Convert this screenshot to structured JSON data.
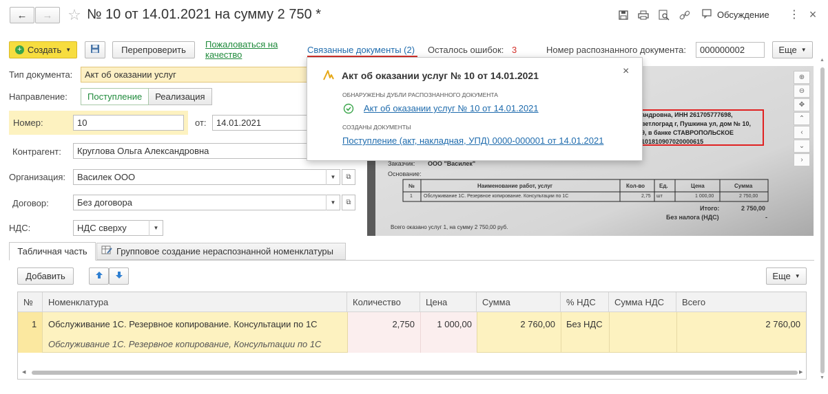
{
  "window": {
    "title": "№ 10 от 14.01.2021 на сумму 2 750 *",
    "discussion_label": "Обсуждение"
  },
  "toolbar": {
    "create_label": "Создать",
    "recheck_label": "Перепроверить",
    "complain_line1": "Пожаловаться на",
    "complain_line2": "качество",
    "related_docs_label": "Связанные документы (2)",
    "errors_label": "Осталось ошибок:",
    "errors_count": "3",
    "recognized_number_label": "Номер распознанного документа:",
    "recognized_number_value": "000000002",
    "more_label": "Еще"
  },
  "form": {
    "doc_type_label": "Тип документа:",
    "doc_type_value": "Акт об оказании услуг",
    "direction_label": "Направление:",
    "direction_options": [
      "Поступление",
      "Реализация"
    ],
    "number_label": "Номер:",
    "number_value": "10",
    "from_label": "от:",
    "date_value": "14.01.2021",
    "counterparty_label": "Контрагент:",
    "counterparty_value": "Круглова Ольга Александровна",
    "organization_label": "Организация:",
    "organization_value": "Василек ООО",
    "contract_label": "Договор:",
    "contract_value": "Без договора",
    "vat_label": "НДС:",
    "vat_value": "НДС сверху"
  },
  "popup": {
    "title": "Акт об оказании услуг № 10 от 14.01.2021",
    "section1_heading": "ОБНАРУЖЕНЫ ДУБЛИ РАСПОЗНАННОГО ДОКУМЕНТА",
    "duplicate_link": "Акт об оказании услуг № 10 от 14.01.2021",
    "section2_heading": "СОЗДАНЫ ДОКУМЕНТЫ",
    "created_link": "Поступление (акт, накладная, УПД) 0000-000001 от 14.01.2021"
  },
  "scan": {
    "highlight_lines": [
      "андровна, ИНН 261705777698,",
      "ветлоград г, Пушкина ул, дом № 10,",
      "9, в банке СТАВРОПОЛЬСКОЕ",
      "101810907020000615"
    ],
    "customer_label": "Заказчик:",
    "customer_value": "ООО \"Василек\"",
    "basis_label": "Основание:",
    "table_headers": [
      "№",
      "Наименование работ, услуг",
      "Кол-во",
      "Ед.",
      "Цена",
      "Сумма"
    ],
    "table_row": [
      "1",
      "Обслуживание 1С. Резервное копирование. Консультации по 1С",
      "2,75",
      "шт",
      "1 000,00",
      "2 750,00"
    ],
    "total_label": "Итого:",
    "total_value": "2 750,00",
    "no_vat_label": "Без налога (НДС)",
    "no_vat_value": "-",
    "footer_text": "Всего оказано услуг 1, на сумму 2 750,00 руб."
  },
  "tabs": [
    "Табличная часть",
    "Групповое создание нераспознанной номенклатуры"
  ],
  "table": {
    "add_label": "Добавить",
    "more_label": "Еще",
    "columns": [
      "№",
      "Номенклатура",
      "Количество",
      "Цена",
      "Сумма",
      "% НДС",
      "Сумма НДС",
      "Всего"
    ],
    "rows": [
      {
        "num": "1",
        "item": "Обслуживание 1С. Резервное копирование. Консультации по 1С",
        "item_recognized": "Обслуживание 1С. Резервное копирование, Консультации по 1С",
        "qty": "2,750",
        "price": "1 000,00",
        "sum": "2 760,00",
        "vat_rate": "Без НДС",
        "vat_sum": "",
        "total": "2 760,00"
      }
    ]
  },
  "colors": {
    "accent_yellow": "#f7dd3f",
    "highlight_row": "#fdf2c0",
    "link": "#1e6bad",
    "error_red": "#d3302a",
    "green": "#1f8a3b"
  }
}
